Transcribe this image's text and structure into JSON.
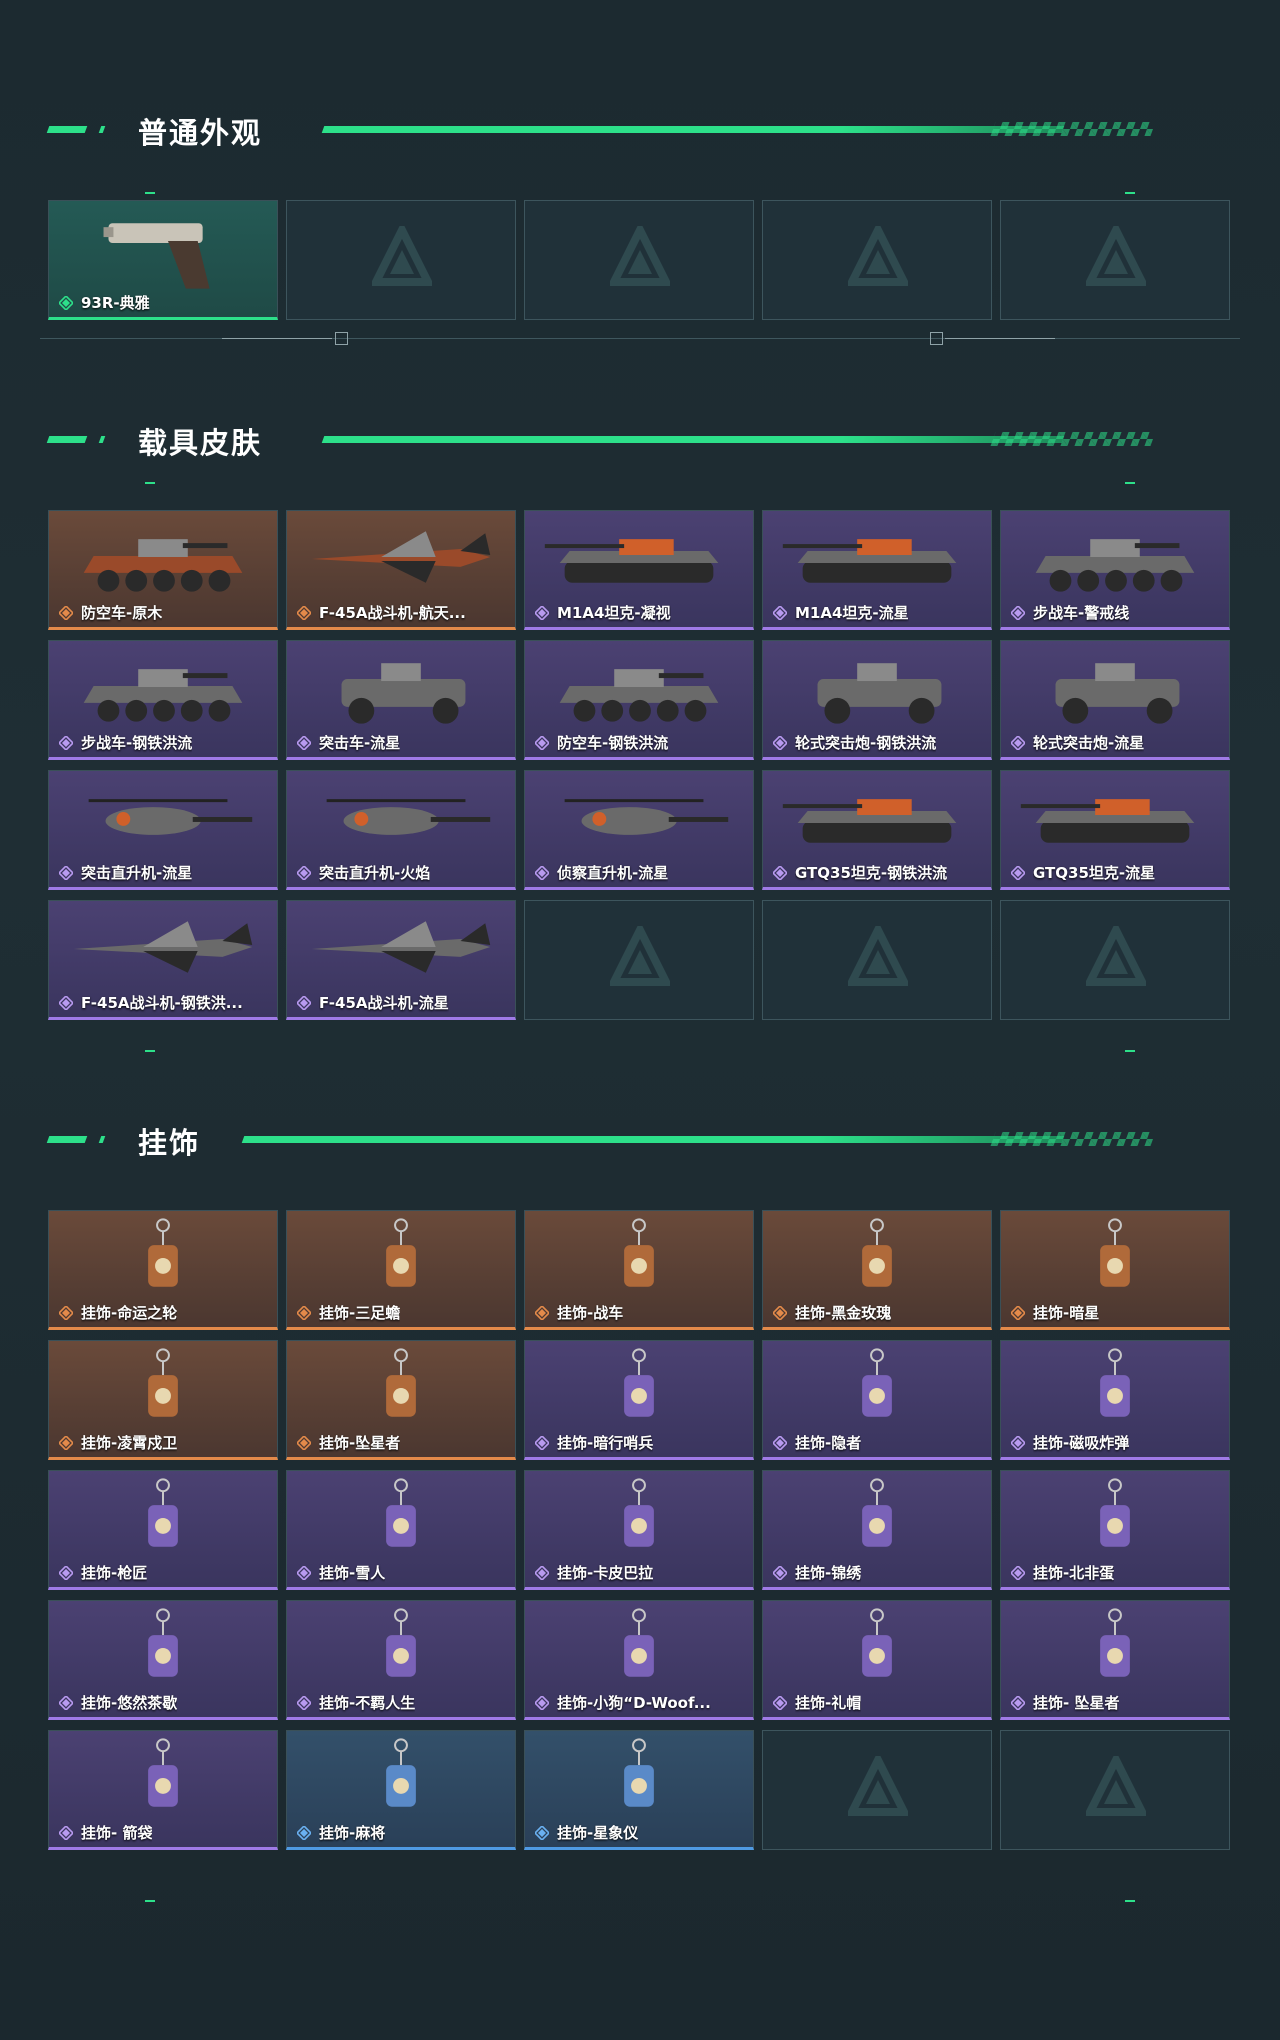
{
  "sections": {
    "general": {
      "title": "普通外观",
      "items": [
        {
          "label": "93R-典雅",
          "rarity": "green",
          "icon": "pistol"
        },
        {
          "label": "",
          "rarity": "empty"
        },
        {
          "label": "",
          "rarity": "empty"
        },
        {
          "label": "",
          "rarity": "empty"
        },
        {
          "label": "",
          "rarity": "empty"
        }
      ]
    },
    "vehicles": {
      "title": "载具皮肤",
      "items": [
        {
          "label": "防空车-原木",
          "rarity": "orange",
          "icon": "apc"
        },
        {
          "label": "F-45A战斗机-航天...",
          "rarity": "orange",
          "icon": "jet"
        },
        {
          "label": "M1A4坦克-凝视",
          "rarity": "purple",
          "icon": "tank"
        },
        {
          "label": "M1A4坦克-流星",
          "rarity": "purple",
          "icon": "tank"
        },
        {
          "label": "步战车-警戒线",
          "rarity": "purple",
          "icon": "apc"
        },
        {
          "label": "步战车-钢铁洪流",
          "rarity": "purple",
          "icon": "apc"
        },
        {
          "label": "突击车-流星",
          "rarity": "purple",
          "icon": "truck"
        },
        {
          "label": "防空车-钢铁洪流",
          "rarity": "purple",
          "icon": "apc"
        },
        {
          "label": "轮式突击炮-钢铁洪流",
          "rarity": "purple",
          "icon": "truck"
        },
        {
          "label": "轮式突击炮-流星",
          "rarity": "purple",
          "icon": "truck"
        },
        {
          "label": "突击直升机-流星",
          "rarity": "purple",
          "icon": "heli"
        },
        {
          "label": "突击直升机-火焰",
          "rarity": "purple",
          "icon": "heli"
        },
        {
          "label": "侦察直升机-流星",
          "rarity": "purple",
          "icon": "heli"
        },
        {
          "label": "GTQ35坦克-钢铁洪流",
          "rarity": "purple",
          "icon": "tank"
        },
        {
          "label": "GTQ35坦克-流星",
          "rarity": "purple",
          "icon": "tank"
        },
        {
          "label": "F-45A战斗机-钢铁洪...",
          "rarity": "purple",
          "icon": "jet"
        },
        {
          "label": "F-45A战斗机-流星",
          "rarity": "purple",
          "icon": "jet"
        },
        {
          "label": "",
          "rarity": "empty"
        },
        {
          "label": "",
          "rarity": "empty"
        },
        {
          "label": "",
          "rarity": "empty"
        }
      ]
    },
    "charms": {
      "title": "挂饰",
      "items": [
        {
          "label": "挂饰-命运之轮",
          "rarity": "orange",
          "icon": "charm"
        },
        {
          "label": "挂饰-三足蟾",
          "rarity": "orange",
          "icon": "charm"
        },
        {
          "label": "挂饰-战车",
          "rarity": "orange",
          "icon": "charm"
        },
        {
          "label": "挂饰-黑金玫瑰",
          "rarity": "orange",
          "icon": "charm"
        },
        {
          "label": "挂饰-暗星",
          "rarity": "orange",
          "icon": "charm"
        },
        {
          "label": "挂饰-凌霄戍卫",
          "rarity": "orange",
          "icon": "charm"
        },
        {
          "label": "挂饰-坠星者",
          "rarity": "orange",
          "icon": "charm"
        },
        {
          "label": "挂饰-暗行哨兵",
          "rarity": "purple",
          "icon": "charm"
        },
        {
          "label": "挂饰-隐者",
          "rarity": "purple",
          "icon": "charm"
        },
        {
          "label": "挂饰-磁吸炸弹",
          "rarity": "purple",
          "icon": "charm"
        },
        {
          "label": "挂饰-枪匠",
          "rarity": "purple",
          "icon": "charm"
        },
        {
          "label": "挂饰-雪人",
          "rarity": "purple",
          "icon": "charm"
        },
        {
          "label": "挂饰-卡皮巴拉",
          "rarity": "purple",
          "icon": "charm"
        },
        {
          "label": "挂饰-锦绣",
          "rarity": "purple",
          "icon": "charm"
        },
        {
          "label": "挂饰-北非蛋",
          "rarity": "purple",
          "icon": "charm"
        },
        {
          "label": "挂饰-悠然茶歇",
          "rarity": "purple",
          "icon": "charm"
        },
        {
          "label": "挂饰-不羁人生",
          "rarity": "purple",
          "icon": "charm"
        },
        {
          "label": "挂饰-小狗“D-Woof...",
          "rarity": "purple",
          "icon": "charm"
        },
        {
          "label": "挂饰-礼帽",
          "rarity": "purple",
          "icon": "charm"
        },
        {
          "label": "挂饰- 坠星者",
          "rarity": "purple",
          "icon": "charm"
        },
        {
          "label": "挂饰- 箭袋",
          "rarity": "purple",
          "icon": "charm"
        },
        {
          "label": "挂饰-麻将",
          "rarity": "blue",
          "icon": "charm"
        },
        {
          "label": "挂饰-星象仪",
          "rarity": "blue",
          "icon": "charm"
        },
        {
          "label": "",
          "rarity": "empty"
        },
        {
          "label": "",
          "rarity": "empty"
        }
      ]
    }
  },
  "colors": {
    "accent": "#2de08a",
    "orange": "#e38a4a",
    "purple": "#9f7ae6",
    "blue": "#4f9ae3"
  }
}
